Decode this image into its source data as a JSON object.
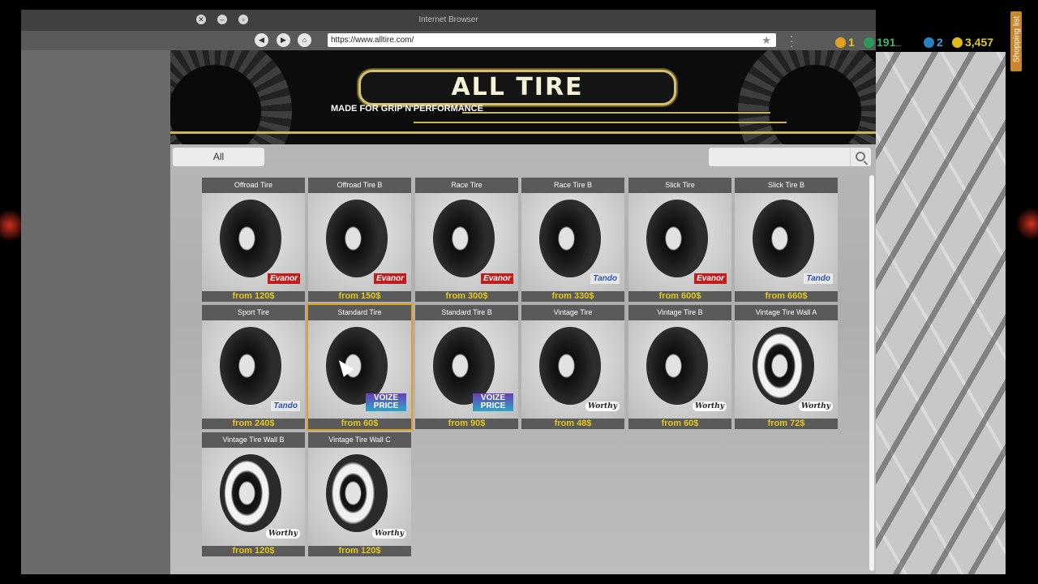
{
  "window": {
    "title": "Internet Browser",
    "url": "https://www.alltire.com/"
  },
  "hud": {
    "level": "1",
    "xp": "191",
    "xp_suffix": "...",
    "clock_count": "2",
    "money": "3,457"
  },
  "shopping_list_label": "Shopping list",
  "banner": {
    "logo_text": "ALL TIRE",
    "tagline": "MADE FOR GRIP'N'PERFORMANCE"
  },
  "category_button": "All",
  "search": {
    "placeholder": ""
  },
  "products": [
    {
      "title": "Offroad Tire",
      "price": "from 120$",
      "brand": "Evanor",
      "style": "plain"
    },
    {
      "title": "Offroad Tire B",
      "price": "from 150$",
      "brand": "Evanor",
      "style": "plain"
    },
    {
      "title": "Race Tire",
      "price": "from 300$",
      "brand": "Evanor",
      "style": "plain"
    },
    {
      "title": "Race Tire B",
      "price": "from 330$",
      "brand": "Tando",
      "style": "plain"
    },
    {
      "title": "Slick Tire",
      "price": "from 600$",
      "brand": "Evanor",
      "style": "plain"
    },
    {
      "title": "Slick Tire B",
      "price": "from 660$",
      "brand": "Tando",
      "style": "plain"
    },
    {
      "title": "Sport Tire",
      "price": "from 240$",
      "brand": "Tando",
      "style": "plain"
    },
    {
      "title": "Standard Tire",
      "price": "from 60$",
      "brand": "VOIZE PRICE",
      "style": "plain",
      "selected": true
    },
    {
      "title": "Standard Tire B",
      "price": "from 90$",
      "brand": "VOIZE PRICE",
      "style": "plain"
    },
    {
      "title": "Vintage Tire",
      "price": "from 48$",
      "brand": "Worthy",
      "style": "plain"
    },
    {
      "title": "Vintage Tire B",
      "price": "from 60$",
      "brand": "Worthy",
      "style": "plain"
    },
    {
      "title": "Vintage Tire Wall A",
      "price": "from 72$",
      "brand": "Worthy",
      "style": "whitewall"
    },
    {
      "title": "Vintage Tire Wall B",
      "price": "from 120$",
      "brand": "Worthy",
      "style": "whitewall"
    },
    {
      "title": "Vintage Tire Wall C",
      "price": "from 120$",
      "brand": "Worthy",
      "style": "whitewall2"
    }
  ],
  "colors": {
    "price_text": "#e3c81e",
    "card_header": "#5a5a5a",
    "selection_outline": "#e0a21c",
    "logo_gold": "#d4c070"
  }
}
